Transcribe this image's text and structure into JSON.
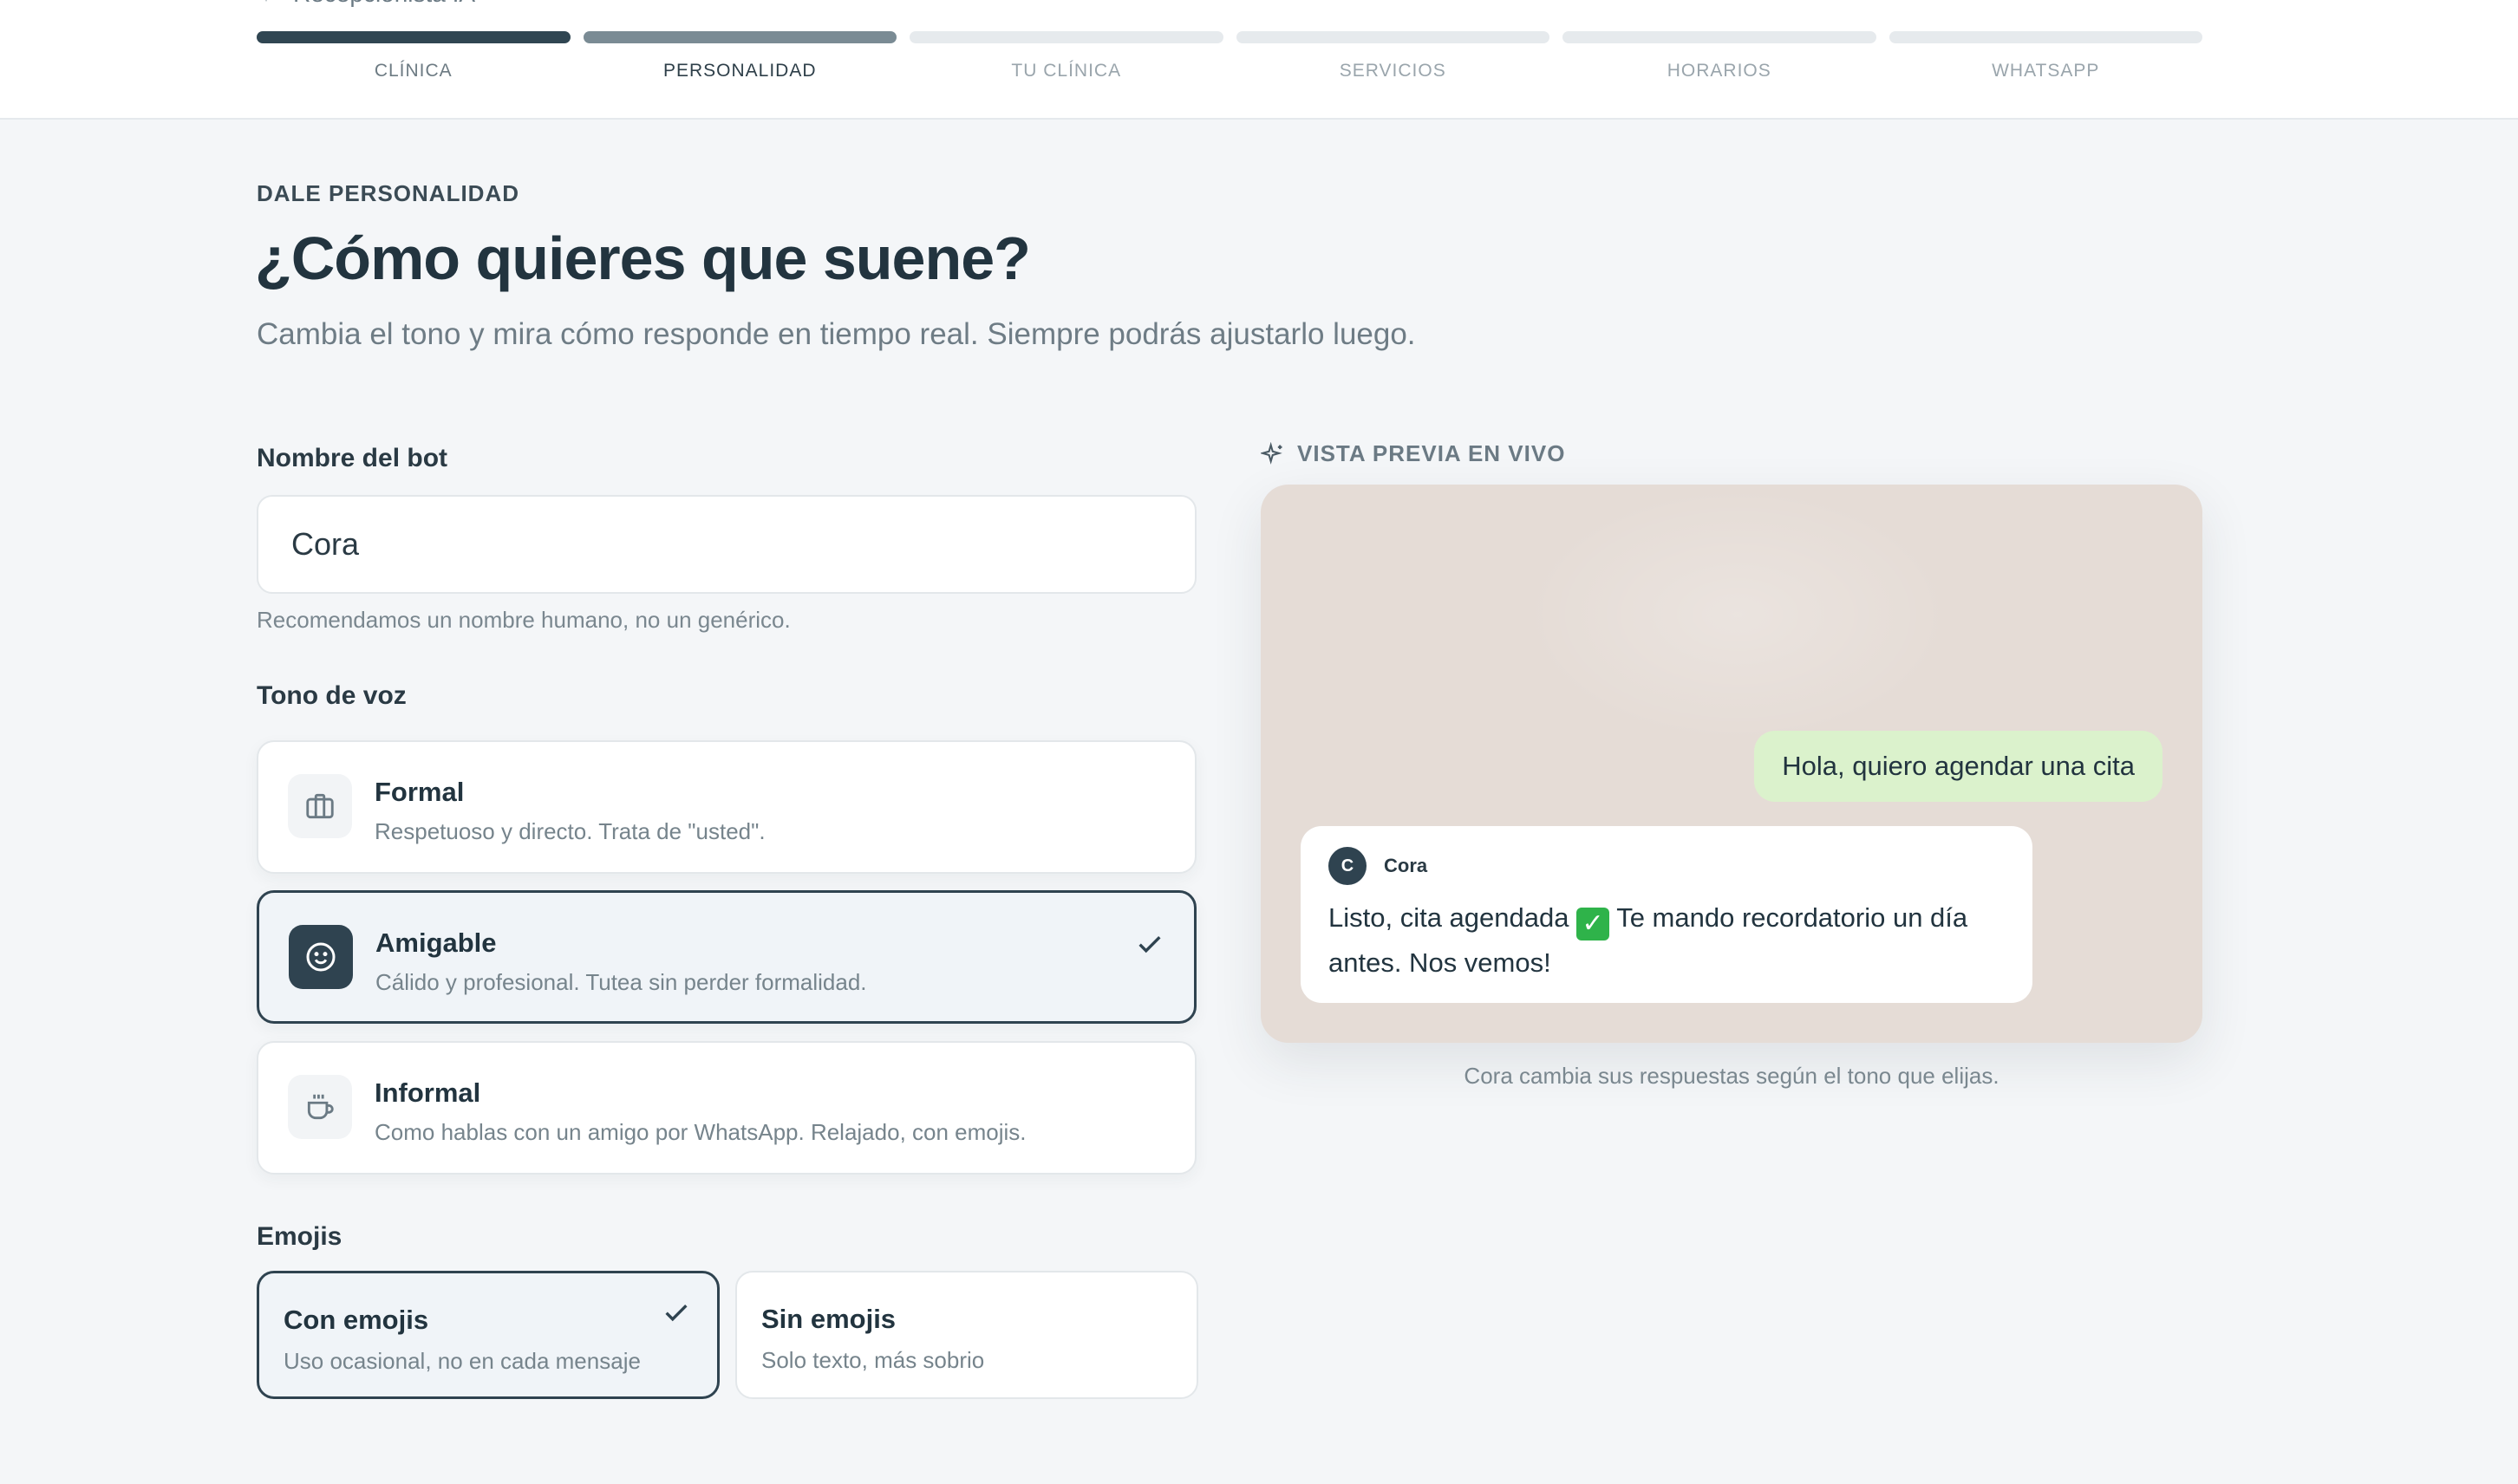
{
  "app": {
    "name": "Recepcionista IA"
  },
  "steps": [
    {
      "label": "CLÍNICA",
      "state": "done"
    },
    {
      "label": "PERSONALIDAD",
      "state": "active"
    },
    {
      "label": "TU CLÍNICA",
      "state": "pending"
    },
    {
      "label": "SERVICIOS",
      "state": "pending"
    },
    {
      "label": "HORARIOS",
      "state": "pending"
    },
    {
      "label": "WHATSAPP",
      "state": "pending"
    }
  ],
  "header": {
    "eyebrow": "DALE PERSONALIDAD",
    "title": "¿Cómo quieres que suene?",
    "subtitle": "Cambia el tono y mira cómo responde en tiempo real. Siempre podrás ajustarlo luego."
  },
  "bot_name": {
    "label": "Nombre del bot",
    "value": "Cora",
    "hint": "Recomendamos un nombre humano, no un genérico."
  },
  "tone": {
    "label": "Tono de voz",
    "options": [
      {
        "title": "Formal",
        "desc": "Respetuoso y directo. Trata de \"usted\".",
        "icon": "briefcase-icon",
        "selected": false
      },
      {
        "title": "Amigable",
        "desc": "Cálido y profesional. Tutea sin perder formalidad.",
        "icon": "smile-icon",
        "selected": true
      },
      {
        "title": "Informal",
        "desc": "Como hablas con un amigo por WhatsApp. Relajado, con emojis.",
        "icon": "coffee-icon",
        "selected": false
      }
    ]
  },
  "emojis": {
    "label": "Emojis",
    "options": [
      {
        "title": "Con emojis",
        "desc": "Uso ocasional, no en cada mensaje",
        "selected": true
      },
      {
        "title": "Sin emojis",
        "desc": "Solo texto, más sobrio",
        "selected": false
      }
    ]
  },
  "preview": {
    "label": "VISTA PREVIA EN VIVO",
    "user_message": "Hola, quiero agendar una cita",
    "bot_initial": "C",
    "bot_name": "Cora",
    "bot_message_before": "Listo, cita agendada",
    "bot_message_emoji": "✓",
    "bot_message_after": "Te mando recordatorio un día antes. Nos vemos!",
    "caption": "Cora cambia sus respuestas según el tono que elijas."
  },
  "colors": {
    "primary": "#2f4350",
    "chat_background": "#e5dcd6",
    "outgoing_bubble": "#dbf2cc",
    "emoji_check": "#2fb34a"
  }
}
